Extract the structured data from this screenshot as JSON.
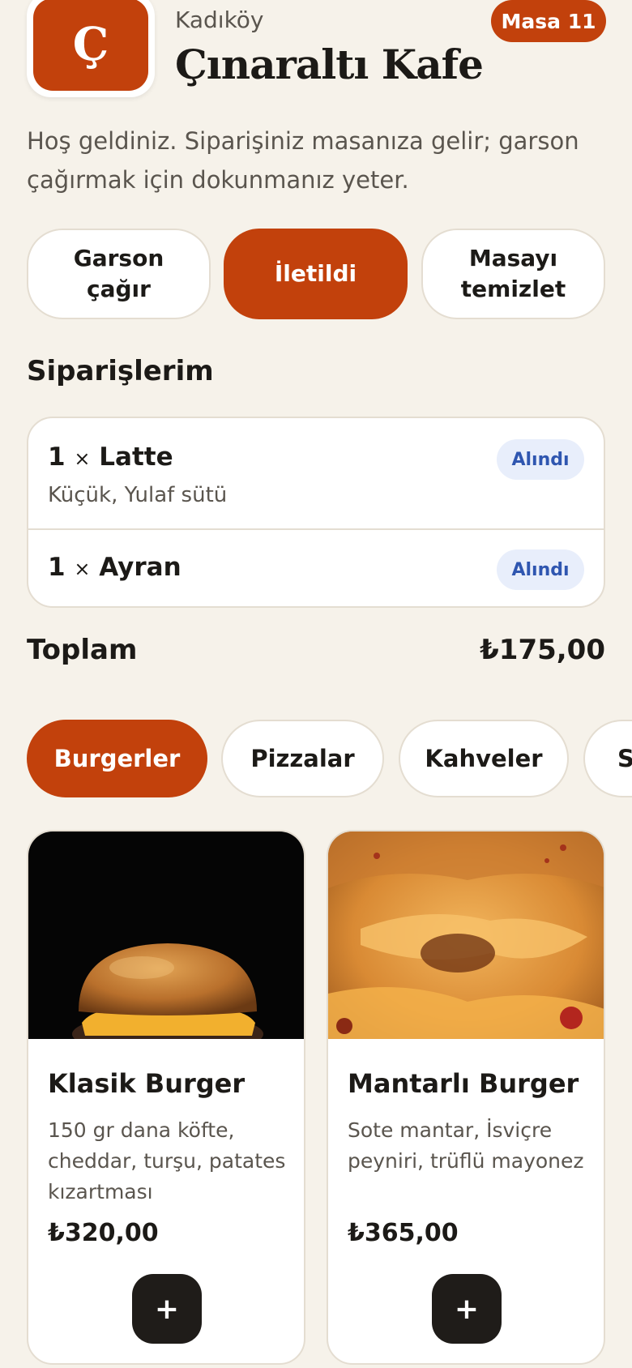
{
  "header": {
    "logo_letter": "Ç",
    "district": "Kadıköy",
    "cafe_name": "Çınaraltı Kafe",
    "table_badge": "Masa 11",
    "welcome": "Hoş geldiniz. Siparişiniz masanıza gelir; garson çağırmak için dokunmanız yeter."
  },
  "actions": [
    {
      "label": "Garson çağır",
      "active": false
    },
    {
      "label": "İletildi",
      "active": true
    },
    {
      "label": "Masayı temizlet",
      "active": false
    }
  ],
  "orders": {
    "title": "Siparişlerim",
    "items": [
      {
        "qty": "1",
        "times": "×",
        "name": "Latte",
        "detail": "Küçük, Yulaf sütü",
        "status": "Alındı"
      },
      {
        "qty": "1",
        "times": "×",
        "name": "Ayran",
        "detail": "",
        "status": "Alındı"
      }
    ],
    "total_label": "Toplam",
    "total_value": "₺175,00"
  },
  "categories": [
    {
      "label": "Burgerler",
      "active": true
    },
    {
      "label": "Pizzalar",
      "active": false
    },
    {
      "label": "Kahveler",
      "active": false
    },
    {
      "label": "S",
      "active": false
    }
  ],
  "products": [
    {
      "name": "Klasik Burger",
      "description": "150 gr dana köfte, cheddar, turşu, patates kızartması",
      "price": "₺320,00",
      "add_label": "+"
    },
    {
      "name": "Mantarlı Burger",
      "description": "Sote mantar, İsviçre peyniri, trüflü mayonez",
      "price": "₺365,00",
      "add_label": "+"
    }
  ],
  "colors": {
    "accent": "#c2410c",
    "background": "#f6f2ea",
    "status_bg": "#e8eefb",
    "status_text": "#2f56b0"
  }
}
